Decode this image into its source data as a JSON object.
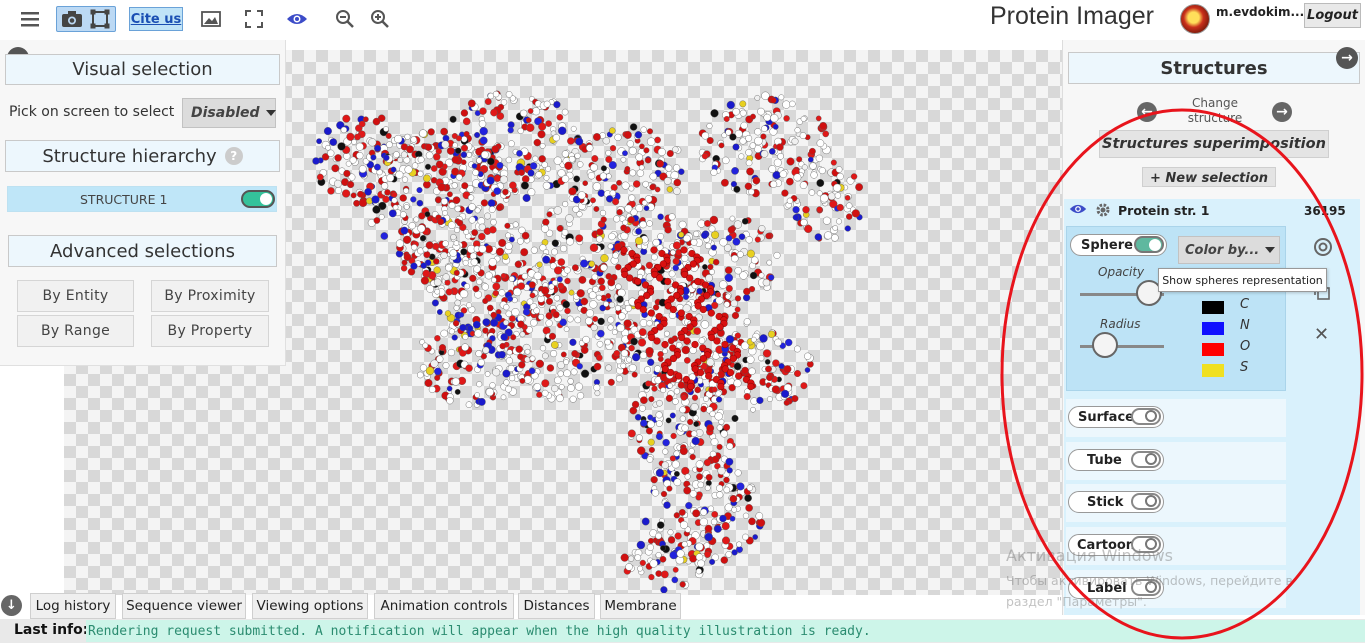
{
  "app": {
    "title": "Protein Imager",
    "username": "m.evdokim...",
    "logout_label": "Logout",
    "cite_label": "Cite us"
  },
  "toolbar": {
    "icons": [
      "menu-icon",
      "camera-icon",
      "frame-icon",
      "image-icon",
      "fullscreen-icon",
      "eye-icon",
      "zoom-out-icon",
      "zoom-in-icon"
    ]
  },
  "left_panel": {
    "visual_selection_title": "Visual selection",
    "pick_label": "Pick on screen to select",
    "pick_value": "Disabled",
    "hierarchy_title": "Structure hierarchy",
    "help_glyph": "?",
    "structure_name": "STRUCTURE 1",
    "advanced_title": "Advanced selections",
    "buttons": [
      "By Entity",
      "By Proximity",
      "By Range",
      "By Property"
    ]
  },
  "right_panel": {
    "structures_title": "Structures",
    "change_structure": "Change structure",
    "superimposition_label": "Structures superimposition",
    "new_selection_label": "+ New selection",
    "protein_name": "Protein str. 1",
    "atom_count": "36195",
    "sphere_label": "Sphere",
    "color_by_label": "Color by...",
    "opacity_label": "Opacity",
    "radius_label": "Radius",
    "opacity_value": 0.82,
    "radius_value": 0.3,
    "tooltip": "Show spheres representation",
    "legend": [
      {
        "element": "C",
        "color": "#000000"
      },
      {
        "element": "N",
        "color": "#1010ff"
      },
      {
        "element": "O",
        "color": "#ff0000"
      },
      {
        "element": "S",
        "color": "#f0e020"
      }
    ],
    "representations": [
      "Surface",
      "Tube",
      "Stick",
      "Cartoon",
      "Label"
    ],
    "close_glyph": "✕"
  },
  "bottom_tabs": [
    "Log history",
    "Sequence viewer",
    "Viewing options",
    "Animation controls",
    "Distances",
    "Membrane"
  ],
  "status": {
    "label": "Last info:",
    "message": "Rendering request submitted. A notification will appear when the high quality illustration is ready."
  },
  "watermark": {
    "line1": "Активация Windows",
    "line2": "Чтобы активировать Windows, перейдите в раздел \"Параметры\"."
  },
  "colors": {
    "accent": "#34c29b",
    "panel_blue": "#bde3f6",
    "status_green": "#cdf5e9",
    "annotation_red": "#e8141c"
  }
}
